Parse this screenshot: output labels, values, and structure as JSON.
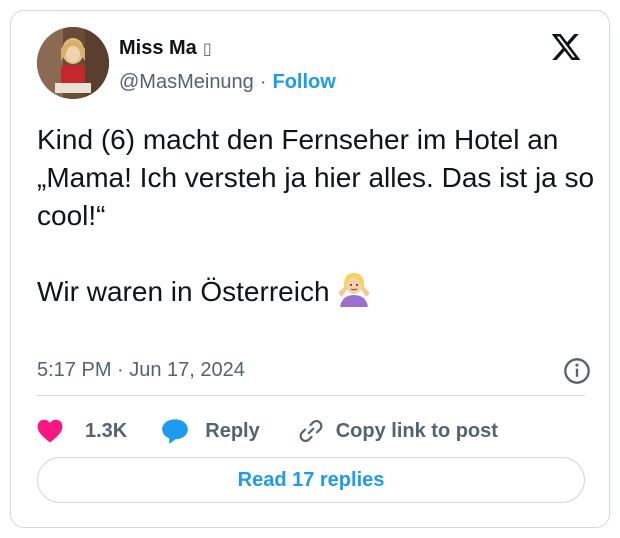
{
  "author": {
    "display_name": "Miss Ma",
    "name_suffix": "▯",
    "handle": "@MasMeinung",
    "separator": "·",
    "follow_label": "Follow"
  },
  "tweet": {
    "text": "Kind (6) macht den Fernseher im Hotel an\n„Mama! Ich versteh ja hier alles. Das ist ja so cool!“\n\nWir waren in Österreich",
    "trailing_emoji": "person-shrugging-emoji",
    "timestamp": "5:17 PM · Jun 17, 2024"
  },
  "actions": {
    "like_count": "1.3K",
    "reply_label": "Reply",
    "copy_link_label": "Copy link to post"
  },
  "footer": {
    "read_replies_label": "Read 17 replies"
  },
  "colors": {
    "accent": "#1d9bf0",
    "like": "#f91880",
    "muted": "#536471",
    "border": "#cfd9de"
  },
  "icons": [
    "x-logo-icon",
    "info-icon",
    "heart-icon",
    "reply-bubble-icon",
    "link-icon",
    "person-shrugging-emoji"
  ]
}
